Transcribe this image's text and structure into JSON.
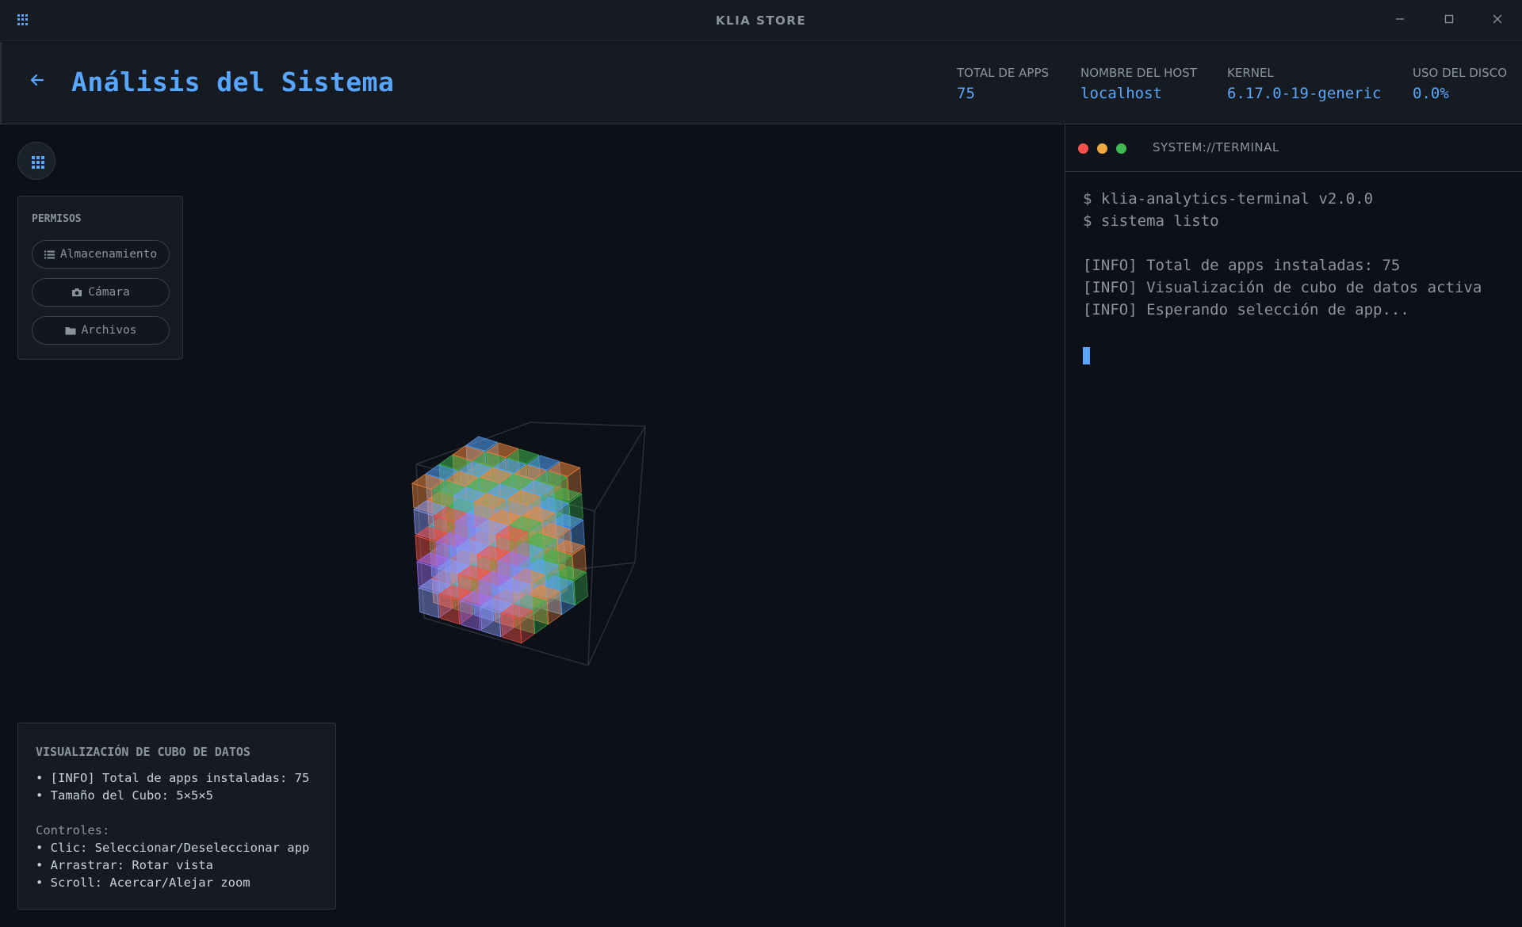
{
  "window": {
    "title": "KLIA STORE"
  },
  "header": {
    "title": "Análisis del Sistema",
    "stats": [
      {
        "label": "TOTAL DE APPS",
        "value": "75"
      },
      {
        "label": "NOMBRE DEL HOST",
        "value": "localhost"
      },
      {
        "label": "KERNEL",
        "value": "6.17.0-19-generic"
      },
      {
        "label": "USO DEL DISCO",
        "value": "0.0%"
      }
    ]
  },
  "permissions": {
    "title": "PERMISOS",
    "items": [
      {
        "label": "Almacenamiento",
        "icon": "list-icon"
      },
      {
        "label": "Cámara",
        "icon": "camera-icon"
      },
      {
        "label": "Archivos",
        "icon": "folder-icon"
      }
    ]
  },
  "info": {
    "title": "VISUALIZACIÓN DE CUBO DE DATOS",
    "lines": [
      "• [INFO] Total de apps instaladas: 75",
      "• Tamaño del Cubo: 5×5×5"
    ],
    "controls_label": "Controles:",
    "controls": [
      "• Clic: Seleccionar/Deseleccionar app",
      "• Arrastrar: Rotar vista",
      "• Scroll: Acercar/Alejar zoom"
    ]
  },
  "terminal": {
    "title": "SYSTEM://TERMINAL",
    "lines": [
      "$ klia-analytics-terminal v2.0.0",
      "$ sistema listo",
      "[INFO] Total de apps instaladas: 75",
      "[INFO] Visualización de cubo de datos activa",
      "[INFO] Esperando selección de app..."
    ]
  },
  "colors": {
    "accent": "#58a6ff",
    "background": "#0d1117",
    "panel": "#161b22",
    "cube_palette": [
      "#3fb950",
      "#f85149",
      "#58a6ff",
      "#a371f7",
      "#f0883e",
      "#8b9cf7"
    ]
  }
}
